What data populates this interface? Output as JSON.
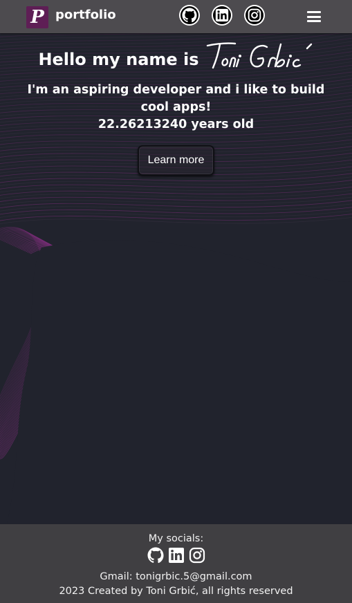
{
  "header": {
    "logo_letter": "P",
    "brand": "portfolio",
    "socials": [
      "github-icon",
      "linkedin-icon",
      "instagram-icon"
    ],
    "menu_icon": "hamburger-icon"
  },
  "hero": {
    "greeting": "Hello my name is",
    "signature_name": "Toni Grbić",
    "tagline": "I'm an aspiring developer and i like to build cool apps!",
    "age": "22.26213240 years old",
    "cta_label": "Learn more"
  },
  "footer": {
    "socials_label": "My socials:",
    "socials": [
      "github-icon",
      "linkedin-icon",
      "instagram-icon"
    ],
    "gmail": "Gmail: tonigrbic.5@gmail.com",
    "copyright": "2023 Created by Toni Grbić, all rights reserved"
  },
  "colors": {
    "background": "#21232d",
    "header": "#4d4b4f",
    "footer": "#403f42",
    "accent": "#5e1e55",
    "wave": "#7a2e78"
  }
}
